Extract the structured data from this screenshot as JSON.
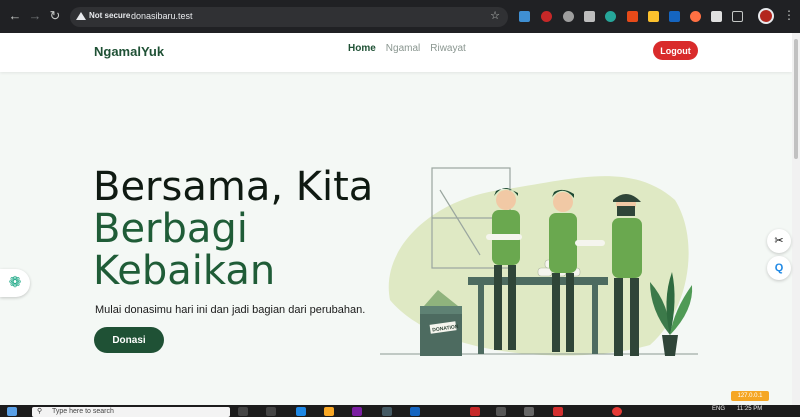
{
  "browser": {
    "security_label": "Not secure",
    "url": "donasibaru.test"
  },
  "site": {
    "brand": "NgamalYuk",
    "nav": [
      {
        "label": "Home",
        "active": true
      },
      {
        "label": "Ngamal",
        "active": false
      },
      {
        "label": "Riwayat",
        "active": false
      }
    ],
    "logout_label": "Logout"
  },
  "hero": {
    "title_line1": "Bersama, Kita",
    "title_line2": "Berbagi",
    "title_line3": "Kebaikan",
    "subtitle": "Mulai donasimu hari ini dan jadi bagian dari perubahan.",
    "cta_label": "Donasi",
    "box_label": "DONATION"
  },
  "overlay": {
    "ip_badge": "127.0.0.1"
  },
  "taskbar": {
    "search_placeholder": "Type here to search",
    "lang": "ENG",
    "time": "11:25 PM"
  },
  "colors": {
    "brand_green": "#1f5135",
    "accent_green": "#1f5c37",
    "logout_red": "#d92b2b",
    "blob": "#dfe9c4"
  },
  "icons": [
    "back-arrow-icon",
    "forward-arrow-icon",
    "reload-icon",
    "warning-icon",
    "star-icon",
    "chatgpt-icon",
    "scissors-icon",
    "q-assistant-icon",
    "search-icon",
    "windows-icon"
  ]
}
